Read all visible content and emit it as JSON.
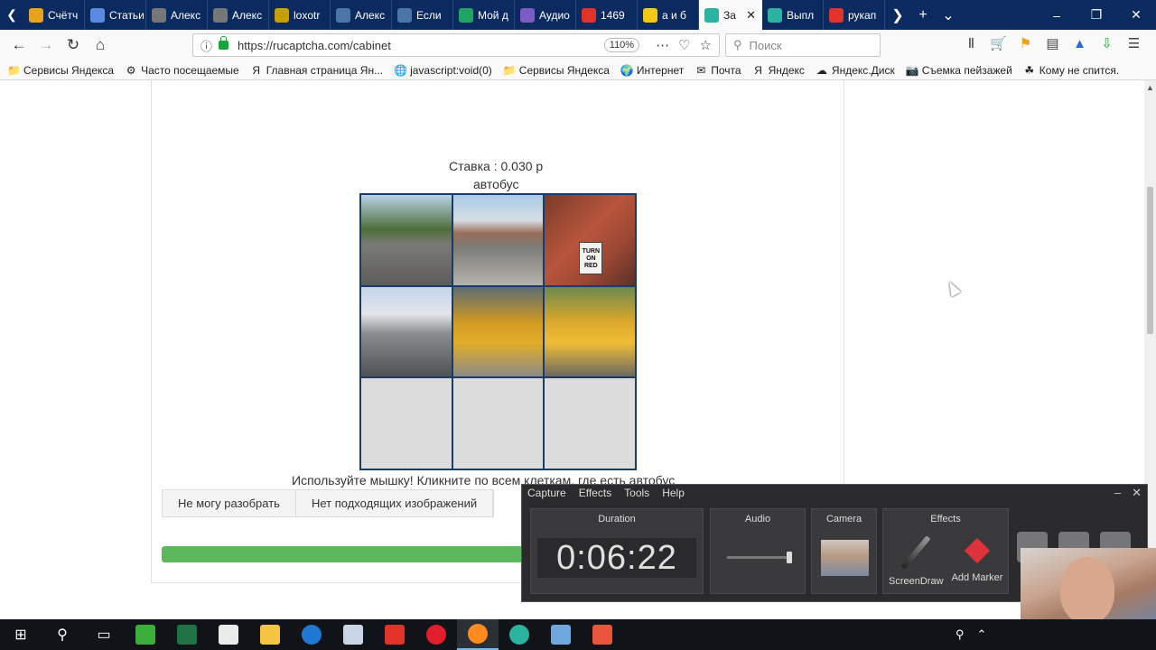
{
  "browser": {
    "tabs": [
      {
        "title": "Счётч",
        "color": "#e8a21b"
      },
      {
        "title": "Статьи",
        "color": "#5b8be0"
      },
      {
        "title": "Алекс",
        "color": "#777777"
      },
      {
        "title": "Алекс",
        "color": "#777777"
      },
      {
        "title": "loxotr",
        "color": "#c7a000"
      },
      {
        "title": "Алекс",
        "color": "#4a76a8"
      },
      {
        "title": "Если",
        "color": "#4a76a8"
      },
      {
        "title": "Мой д",
        "color": "#1fa463"
      },
      {
        "title": "Аудио",
        "color": "#7b5cc4"
      },
      {
        "title": "1469",
        "color": "#e2332b"
      },
      {
        "title": "а и б",
        "color": "#f2c811"
      },
      {
        "title": "За",
        "color": "#2bb3a0"
      },
      {
        "title": "Выпл",
        "color": "#2bb3a0"
      },
      {
        "title": "рукап",
        "color": "#e2332b"
      }
    ],
    "url": "https://rucaptcha.com/cabinet",
    "zoom": "110%",
    "search_placeholder": "Поиск",
    "bookmarks": [
      "Сервисы Яндекса",
      "Часто посещаемые",
      "Главная страница Ян...",
      "javascript:void(0)",
      "Сервисы Яндекса",
      "Интернет",
      "Почта",
      "Яндекс",
      "Яндекс.Диск",
      "Съемка пейзажей",
      "Кому не спится."
    ]
  },
  "captcha": {
    "rate": "Ставка : 0.030 р",
    "keyword": "автобус",
    "instruction": "Используйте мышку! Кликните по всем клеткам, где есть автобус",
    "sign_text": "TURN ON RED",
    "buttons": {
      "cant_solve": "Не могу разобрать",
      "no_images": "Нет подходящих изображений"
    },
    "progress": 1.0
  },
  "recorder": {
    "menu": [
      "Capture",
      "Effects",
      "Tools",
      "Help"
    ],
    "duration_label": "Duration",
    "duration": "0:06:22",
    "audio_label": "Audio",
    "camera_label": "Camera",
    "effects_label": "Effects",
    "screendraw_label": "ScreenDraw",
    "add_marker_label": "Add Marker"
  }
}
